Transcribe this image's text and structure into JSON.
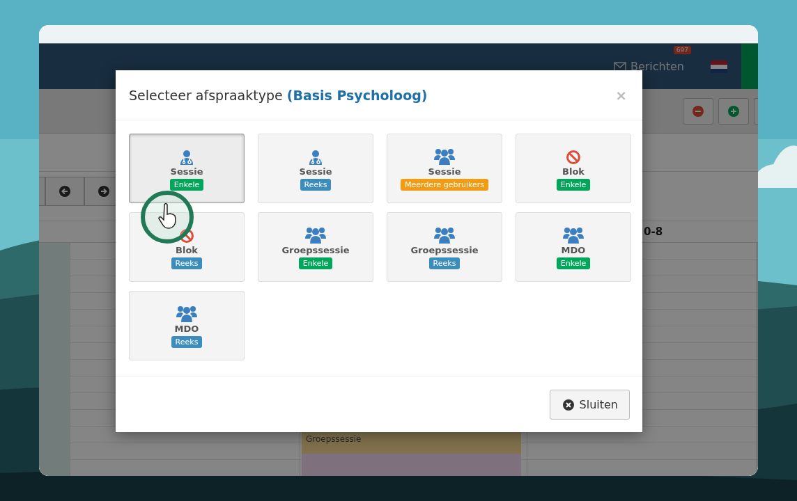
{
  "app": {
    "header": {
      "messages_label": "Berichten",
      "messages_count": "697"
    },
    "calendar": {
      "column_header": "0-8",
      "event": "Groepssessie"
    }
  },
  "modal": {
    "title": "Selecteer afspraaktype",
    "subtitle": "(Basis Psycholoog)",
    "close": "×",
    "cards": [
      {
        "label": "Sessie",
        "kind": "doctor",
        "badge": "Enkele",
        "color": "#00a65a",
        "selected": true
      },
      {
        "label": "Sessie",
        "kind": "doctor",
        "badge": "Reeks",
        "color": "#3c8dbc",
        "selected": false
      },
      {
        "label": "Sessie",
        "kind": "group",
        "badge": "Meerdere gebruikers",
        "color": "#f39c12",
        "selected": false
      },
      {
        "label": "Blok",
        "kind": "block",
        "badge": "Enkele",
        "color": "#00a65a",
        "selected": false
      },
      {
        "label": "Blok",
        "kind": "block",
        "badge": "Reeks",
        "color": "#3c8dbc",
        "selected": false
      },
      {
        "label": "Groepssessie",
        "kind": "group",
        "badge": "Enkele",
        "color": "#00a65a",
        "selected": false
      },
      {
        "label": "Groepssessie",
        "kind": "group",
        "badge": "Reeks",
        "color": "#3c8dbc",
        "selected": false
      },
      {
        "label": "MDO",
        "kind": "group",
        "badge": "Enkele",
        "color": "#00a65a",
        "selected": false
      },
      {
        "label": "MDO",
        "kind": "group",
        "badge": "Reeks",
        "color": "#3c8dbc",
        "selected": false
      }
    ],
    "footer_button": "Sluiten"
  }
}
